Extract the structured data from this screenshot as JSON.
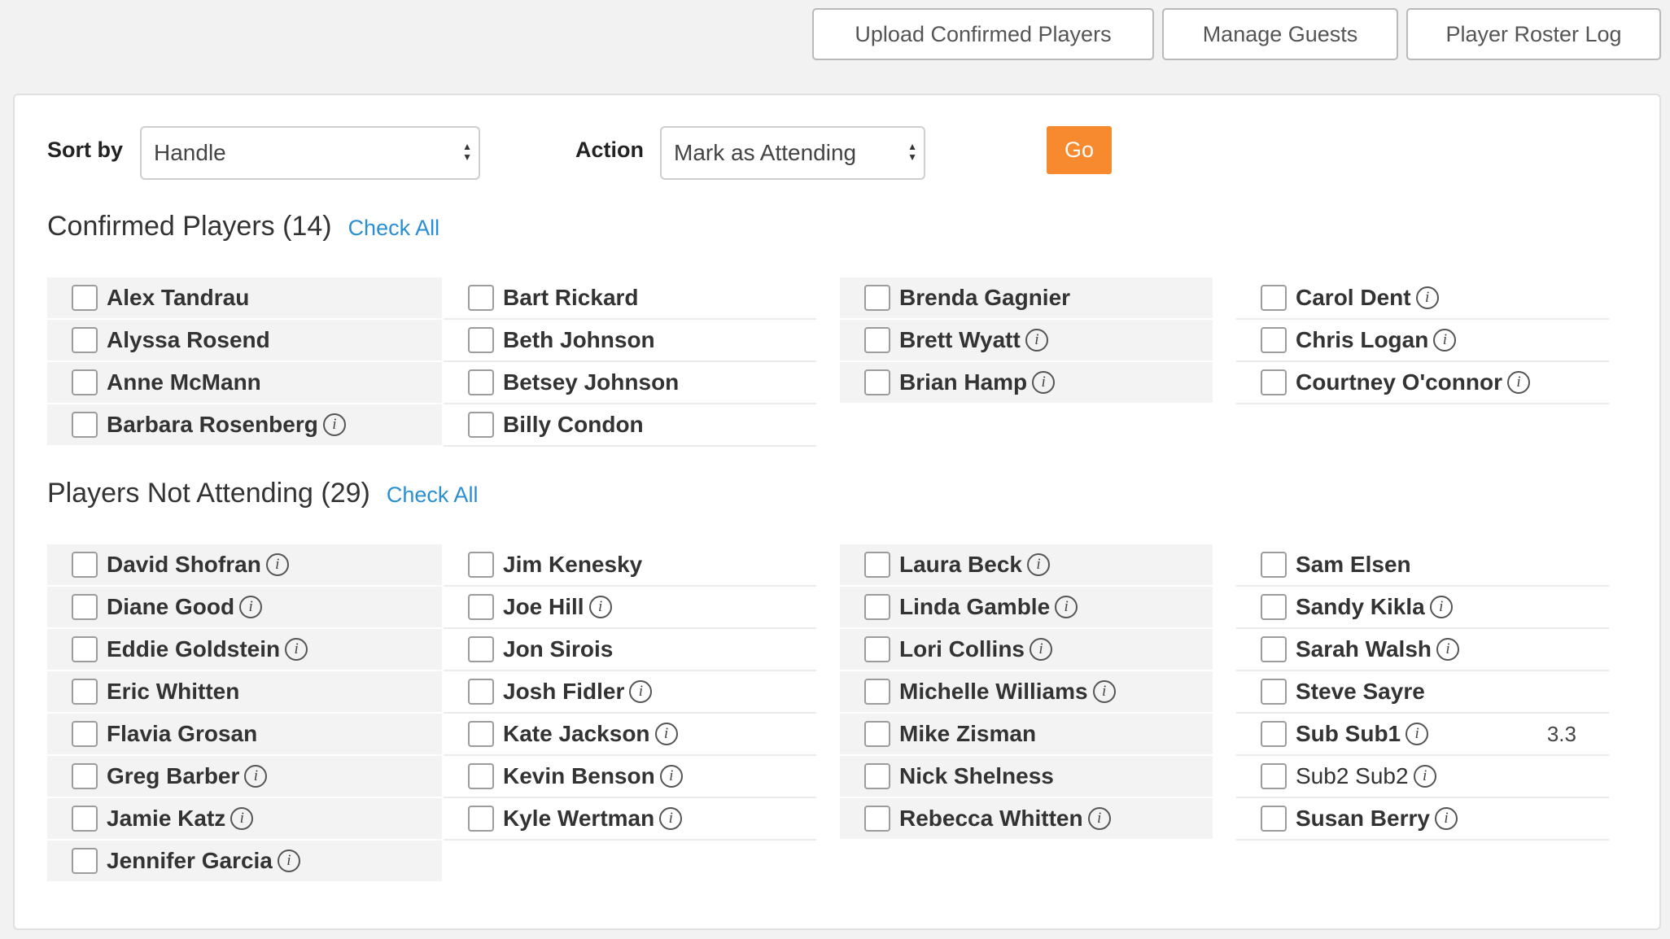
{
  "topbar": {
    "upload_label": "Upload Confirmed Players",
    "guests_label": "Manage Guests",
    "roster_log_label": "Player Roster Log"
  },
  "controls": {
    "sort_label": "Sort by",
    "sort_value": "Handle",
    "action_label": "Action",
    "action_value": "Mark as Attending",
    "go_label": "Go"
  },
  "confirmed": {
    "title": "Confirmed Players (14)",
    "check_all": "Check All",
    "columns": [
      [
        {
          "name": "Alex Tandrau",
          "info": false
        },
        {
          "name": "Alyssa Rosend",
          "info": false
        },
        {
          "name": "Anne McMann",
          "info": false
        },
        {
          "name": "Barbara Rosenberg",
          "info": true
        }
      ],
      [
        {
          "name": "Bart Rickard",
          "info": false
        },
        {
          "name": "Beth Johnson",
          "info": false
        },
        {
          "name": "Betsey Johnson",
          "info": false
        },
        {
          "name": "Billy Condon",
          "info": false
        }
      ],
      [
        {
          "name": "Brenda Gagnier",
          "info": false
        },
        {
          "name": "Brett Wyatt",
          "info": true
        },
        {
          "name": "Brian Hamp",
          "info": true
        }
      ],
      [
        {
          "name": "Carol Dent",
          "info": true
        },
        {
          "name": "Chris Logan",
          "info": true
        },
        {
          "name": "Courtney O'connor",
          "info": true
        }
      ]
    ]
  },
  "not_attending": {
    "title": "Players Not Attending (29)",
    "check_all": "Check All",
    "columns": [
      [
        {
          "name": "David Shofran",
          "info": true
        },
        {
          "name": "Diane Good",
          "info": true
        },
        {
          "name": "Eddie Goldstein",
          "info": true
        },
        {
          "name": "Eric Whitten",
          "info": false
        },
        {
          "name": "Flavia Grosan",
          "info": false
        },
        {
          "name": "Greg Barber",
          "info": true
        },
        {
          "name": "Jamie Katz",
          "info": true
        },
        {
          "name": "Jennifer Garcia",
          "info": true
        }
      ],
      [
        {
          "name": "Jim Kenesky",
          "info": false
        },
        {
          "name": "Joe Hill",
          "info": true
        },
        {
          "name": "Jon Sirois",
          "info": false
        },
        {
          "name": "Josh Fidler",
          "info": true
        },
        {
          "name": "Kate Jackson",
          "info": true
        },
        {
          "name": "Kevin Benson",
          "info": true
        },
        {
          "name": "Kyle Wertman",
          "info": true
        }
      ],
      [
        {
          "name": "Laura Beck",
          "info": true
        },
        {
          "name": "Linda Gamble",
          "info": true
        },
        {
          "name": "Lori Collins",
          "info": true
        },
        {
          "name": "Michelle Williams",
          "info": true
        },
        {
          "name": "Mike Zisman",
          "info": false
        },
        {
          "name": "Nick Shelness",
          "info": false
        },
        {
          "name": "Rebecca Whitten",
          "info": true
        }
      ],
      [
        {
          "name": "Sam Elsen",
          "info": false
        },
        {
          "name": "Sandy Kikla",
          "info": true
        },
        {
          "name": "Sarah Walsh",
          "info": true
        },
        {
          "name": "Steve Sayre",
          "info": false
        },
        {
          "name": "Sub Sub1",
          "info": true,
          "value": "3.3"
        },
        {
          "name": "Sub2 Sub2",
          "info": true,
          "bold": false
        },
        {
          "name": "Susan Berry",
          "info": true
        }
      ]
    ]
  }
}
